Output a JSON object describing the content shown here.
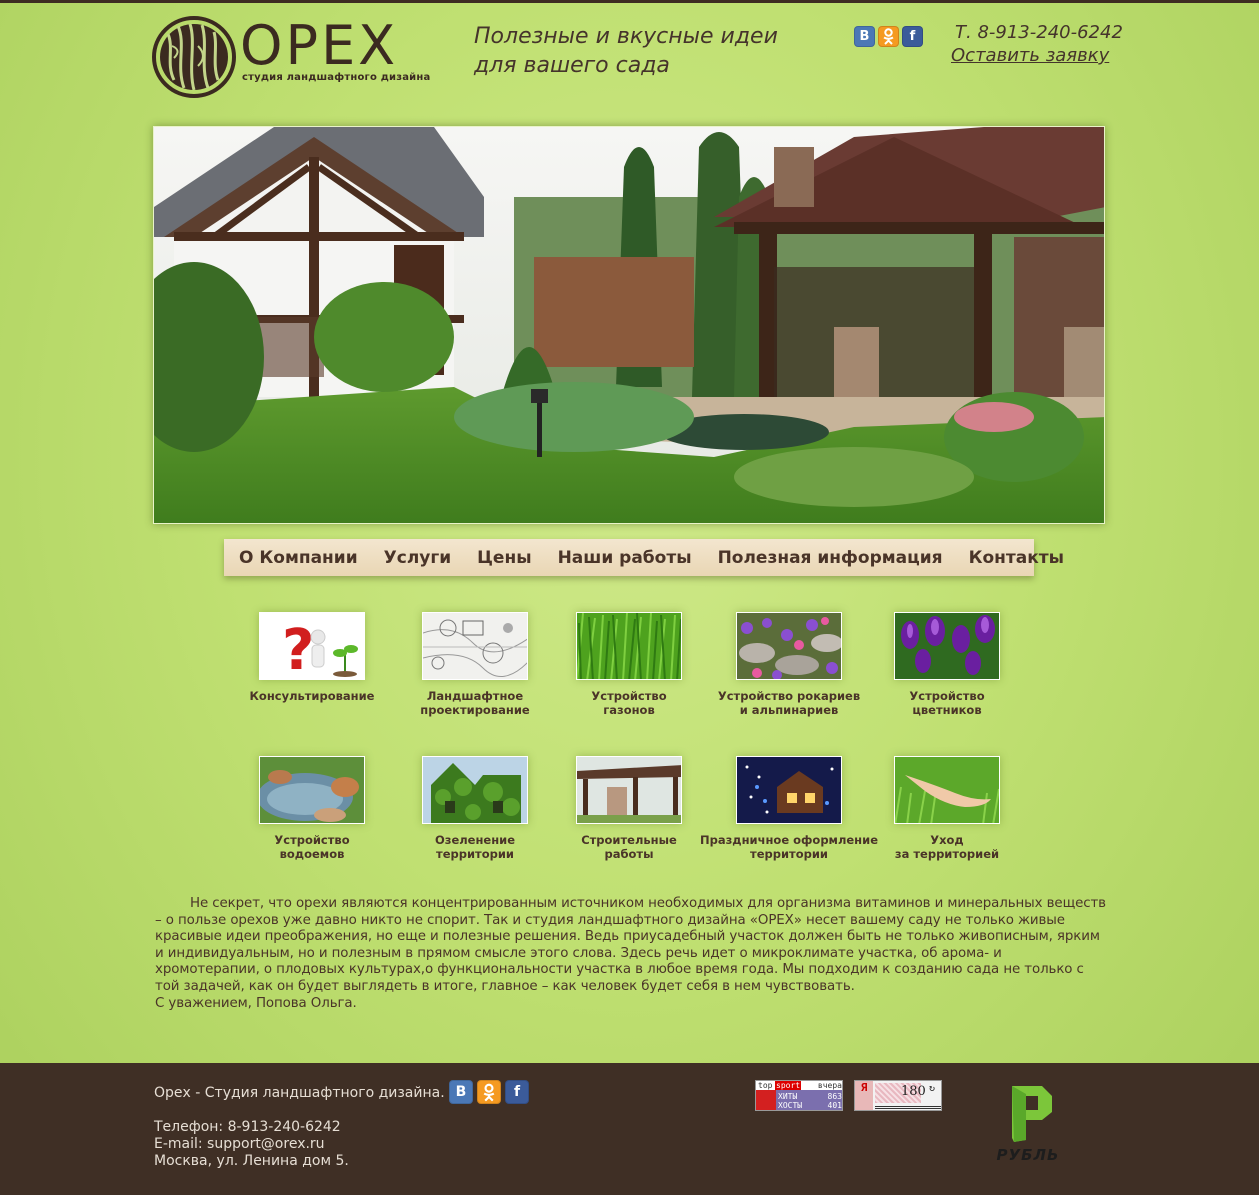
{
  "brand": {
    "name": "ОРЕХ",
    "subtitle": "студия ландшафтного дизайна"
  },
  "header": {
    "slogan_line1": "Полезные и вкусные идеи",
    "slogan_line2": "для вашего сада",
    "phone": "Т. 8-913-240-6242",
    "request_link": "Оставить заявку",
    "social": [
      {
        "icon": "vk-icon",
        "glyph": "В"
      },
      {
        "icon": "odnoklassniki-icon",
        "glyph": "ок"
      },
      {
        "icon": "facebook-icon",
        "glyph": "f"
      }
    ]
  },
  "nav": {
    "items": [
      "О Компании",
      "Услуги",
      "Цены",
      "Наши работы",
      "Полезная информация",
      "Контакты"
    ]
  },
  "services": [
    {
      "label": "Консультирование",
      "image": "consulting-thumbnail"
    },
    {
      "label": "Ландшафтное\nпроектирование",
      "image": "landscape-plan-thumbnail"
    },
    {
      "label": "Устройство\nгазонов",
      "image": "lawn-thumbnail"
    },
    {
      "label": "Устройство рокариев\nи альпинариев",
      "image": "rockery-thumbnail"
    },
    {
      "label": "Устройство\nцветников",
      "image": "flowerbed-thumbnail"
    },
    {
      "label": "Устройство\nводоемов",
      "image": "pond-thumbnail"
    },
    {
      "label": "Озеленение\nтерритории",
      "image": "greening-thumbnail"
    },
    {
      "label": "Строительные\nработы",
      "image": "construction-thumbnail"
    },
    {
      "label": "Праздничное оформление\nтерритории",
      "image": "festive-decor-thumbnail"
    },
    {
      "label": "Уход\nза территорией",
      "image": "care-thumbnail"
    }
  ],
  "intro": {
    "paragraph": "Не секрет, что орехи являются концентрированным источником необходимых для организма витаминов и минеральных веществ – о пользе орехов уже давно никто не спорит. Так и студия ландшафтного дизайна «ОРЕХ» несет вашему саду не только живые красивые идеи преображения, но еще и полезные решения. Ведь приусадебный участок должен быть не только живописным, ярким и индивидуальным, но и полезным в прямом смысле этого слова. Здесь речь идет о микроклимате участка, об арома- и хромотерапии, о плодовых культурах,о функциональности участка в любое время года. Мы подходим к созданию сада не только с той задачей, как он будет выглядеть в итоге, главное – как человек будет себя в нем чувствовать.",
    "signature": "С уважением, Попова Ольга."
  },
  "footer": {
    "company": "Орех - Студия ландшафтного дизайна.",
    "phone": "Телефон: 8-913-240-6242",
    "email": "E-mail: support@orex.ru",
    "address": "Москва, ул. Ленина дом 5.",
    "counter_a": {
      "top_left": "top",
      "top_mid": "sport",
      "top_right": "вчера",
      "row1_label": "ХИТЫ",
      "row1_value": "863",
      "row2_label": "ХОСТЫ",
      "row2_value": "401"
    },
    "counter_b": {
      "letter": "Я",
      "value": "180"
    },
    "rubl_label": "РУБЛЬ"
  },
  "colors": {
    "background": "#c0e072",
    "footer": "#3f2f25",
    "nav": "#efdfc2",
    "text": "#4a3428"
  }
}
